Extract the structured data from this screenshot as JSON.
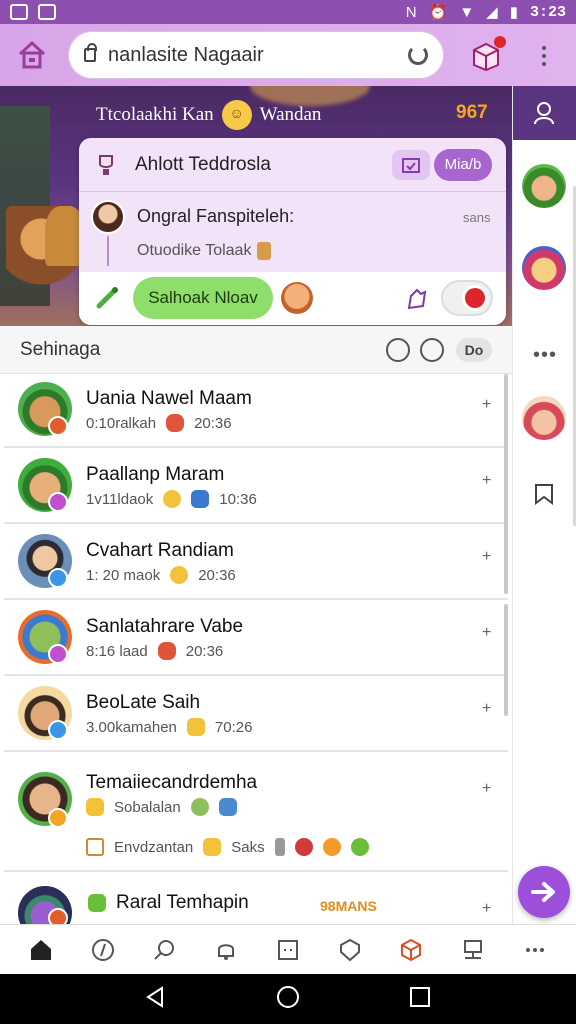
{
  "status_bar": {
    "time": "3:23"
  },
  "browser": {
    "url": "nanlasite Nagaair"
  },
  "banner": {
    "title_left": "Ttcolaakhi Kan",
    "title_right": "Wandan",
    "score": "967"
  },
  "popup": {
    "title": "Ahlott Teddrosla",
    "pill_label": "Mia/b",
    "sender_name": "Ongral Fanspiteleh:",
    "time": "sans",
    "message": "Otuodike Tolaak",
    "green_button": "Salhoak Nloav"
  },
  "list_header": {
    "title": "Sehinaga",
    "dropdown": "Do"
  },
  "chats": [
    {
      "name": "Uania Nawel Maam",
      "sub": "0:10ralkah",
      "meta": "20:36",
      "status_color": "#e35d2a",
      "avatar_bg": "#4caf50",
      "face": "#d89a5c"
    },
    {
      "name": "Paallanp Maram",
      "sub": "1v11ldaok",
      "meta": "10:36",
      "status_color": "#c050d0",
      "avatar_bg": "#3cae3c",
      "face": "#e7b07a"
    },
    {
      "name": "Cvahart Randiam",
      "sub": "1: 20 maok",
      "meta": "20:36",
      "status_color": "#3a95e8",
      "avatar_bg": "#6b8fb7",
      "face": "#f0c8a0"
    },
    {
      "name": "Sanlatahrare Vabe",
      "sub": "8:16 laad",
      "meta": "20:36",
      "status_color": "#c050d0",
      "avatar_bg": "#e86c2a",
      "face": "#8fbf5a"
    },
    {
      "name": "BeoLate Saih",
      "sub": "3.00kamahen",
      "meta": "70:26",
      "status_color": "#3a95e8",
      "avatar_bg": "#f4d9a0",
      "face": "#e0a878"
    },
    {
      "name": "Temaiiecandrdemha",
      "sub": "Sobalalan",
      "sub2": "Envdzantan",
      "sub2b": "Saks",
      "status_color": "#f4a623",
      "avatar_bg": "#55b04a",
      "face": "#e8b48a"
    },
    {
      "name": "Raral Temhapin",
      "tag": "98MANS",
      "status_color": "#e35d2a",
      "avatar_bg": "#2a2e5a",
      "face": "#9a5ed0"
    }
  ]
}
